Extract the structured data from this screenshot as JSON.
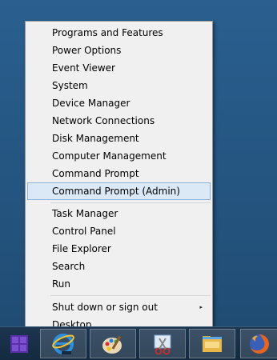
{
  "context_menu": {
    "groups": [
      {
        "items": [
          {
            "label": "Programs and Features"
          },
          {
            "label": "Power Options"
          },
          {
            "label": "Event Viewer"
          },
          {
            "label": "System"
          },
          {
            "label": "Device Manager"
          },
          {
            "label": "Network Connections"
          },
          {
            "label": "Disk Management"
          },
          {
            "label": "Computer Management"
          },
          {
            "label": "Command Prompt"
          },
          {
            "label": "Command Prompt (Admin)",
            "highlighted": true
          }
        ]
      },
      {
        "items": [
          {
            "label": "Task Manager"
          },
          {
            "label": "Control Panel"
          },
          {
            "label": "File Explorer"
          },
          {
            "label": "Search"
          },
          {
            "label": "Run"
          }
        ]
      },
      {
        "items": [
          {
            "label": "Shut down or sign out",
            "submenu_arrow": "▸"
          },
          {
            "label": "Desktop"
          }
        ]
      }
    ]
  },
  "taskbar": {
    "start_icon": "windows-start-icon",
    "apps": [
      {
        "icon": "internet-explorer-icon"
      },
      {
        "icon": "paint-icon"
      },
      {
        "icon": "snipping-tool-icon"
      },
      {
        "icon": "file-explorer-icon"
      },
      {
        "icon": "firefox-icon"
      }
    ]
  },
  "colors": {
    "accent_start": "#5b2fa8",
    "menu_bg": "#f0f0f0",
    "highlight_bg": "#dbe8f5",
    "highlight_border": "#8fb3d9",
    "desktop": "#24547f"
  }
}
